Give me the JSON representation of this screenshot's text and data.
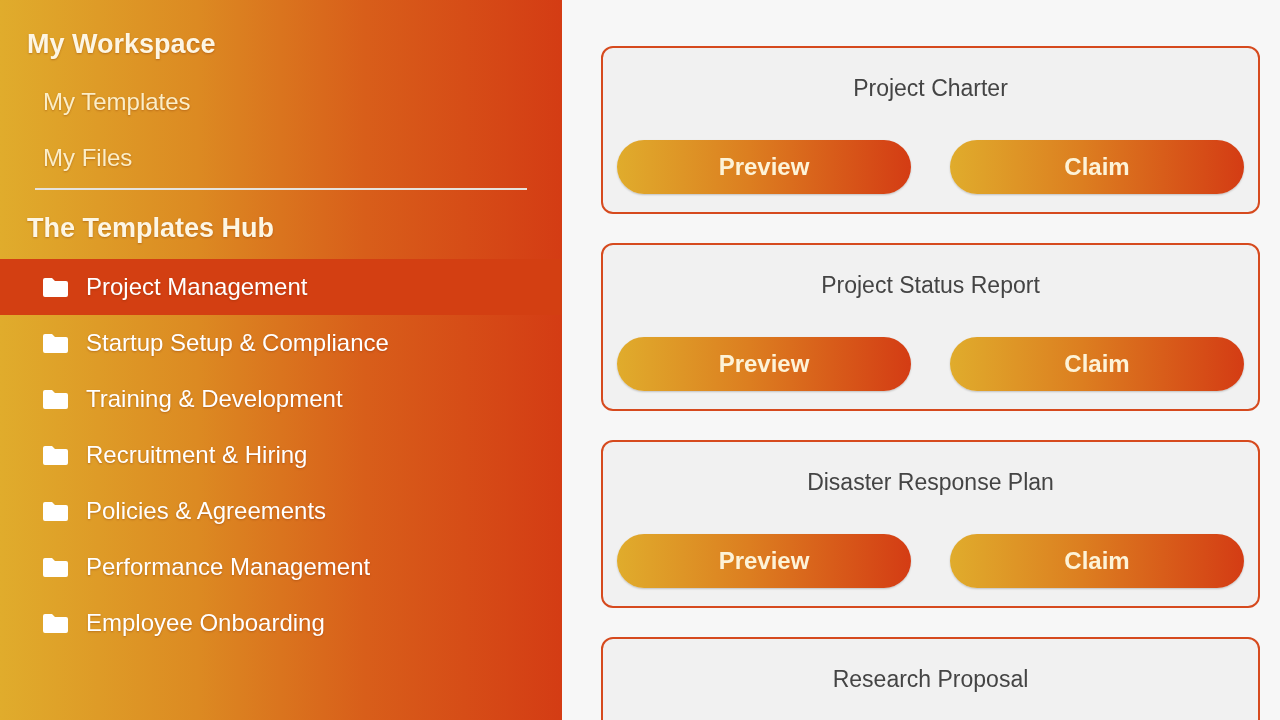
{
  "sidebar": {
    "workspace": {
      "heading": "My Workspace",
      "links": [
        "My Templates",
        "My Files"
      ]
    },
    "hub": {
      "heading": "The Templates Hub",
      "categories": [
        {
          "label": "Project Management",
          "selected": true
        },
        {
          "label": "Startup Setup & Compliance",
          "selected": false
        },
        {
          "label": "Training & Development",
          "selected": false
        },
        {
          "label": "Recruitment & Hiring",
          "selected": false
        },
        {
          "label": "Policies & Agreements",
          "selected": false
        },
        {
          "label": "Performance Management",
          "selected": false
        },
        {
          "label": "Employee Onboarding",
          "selected": false
        }
      ]
    }
  },
  "templates": [
    {
      "title": "Project Charter",
      "buttons": [
        "Preview",
        "Claim"
      ]
    },
    {
      "title": "Project Status Report",
      "buttons": [
        "Preview",
        "Claim"
      ]
    },
    {
      "title": "Disaster Response Plan",
      "buttons": [
        "Preview",
        "Claim"
      ]
    },
    {
      "title": "Research Proposal"
    }
  ]
}
